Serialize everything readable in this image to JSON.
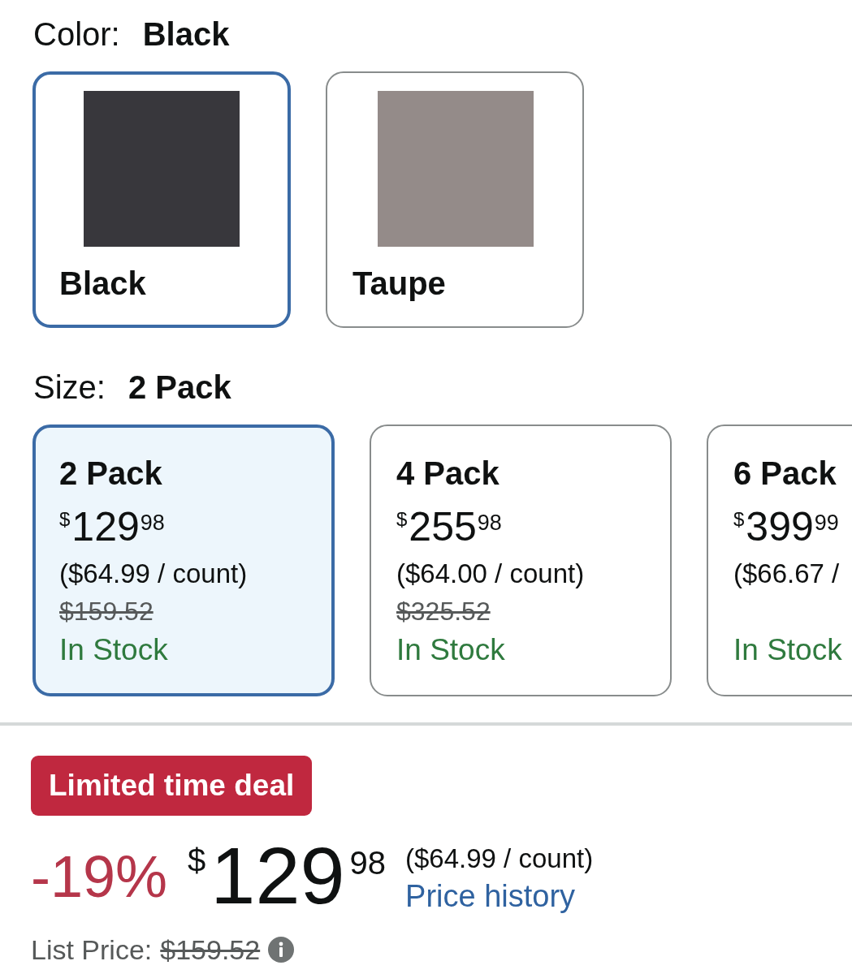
{
  "color_selector": {
    "label": "Color:",
    "value": "Black",
    "options": [
      {
        "name": "Black",
        "color": "#38373c",
        "selected": true
      },
      {
        "name": "Taupe",
        "color": "#948b89",
        "selected": false
      }
    ]
  },
  "size_selector": {
    "label": "Size:",
    "value": "2 Pack",
    "options": [
      {
        "name": "2 Pack",
        "price": {
          "currency": "$",
          "whole": "129",
          "fraction": "98"
        },
        "unit_price": "($64.99 / count)",
        "list_price": "$159.52",
        "availability": "In Stock",
        "selected": true
      },
      {
        "name": "4 Pack",
        "price": {
          "currency": "$",
          "whole": "255",
          "fraction": "98"
        },
        "unit_price": "($64.00 / count)",
        "list_price": "$325.52",
        "availability": "In Stock",
        "selected": false
      },
      {
        "name": "6 Pack",
        "price": {
          "currency": "$",
          "whole": "399",
          "fraction": "99"
        },
        "unit_price": "($66.67 /",
        "availability": "In Stock",
        "selected": false
      }
    ]
  },
  "deal": {
    "badge": "Limited time deal",
    "discount": "-19%",
    "price": {
      "currency": "$",
      "whole": "129",
      "fraction": "98"
    },
    "unit_price": "($64.99 / count)",
    "price_history_link": "Price history",
    "list_price_label": "List Price:",
    "list_price": "$159.52"
  }
}
